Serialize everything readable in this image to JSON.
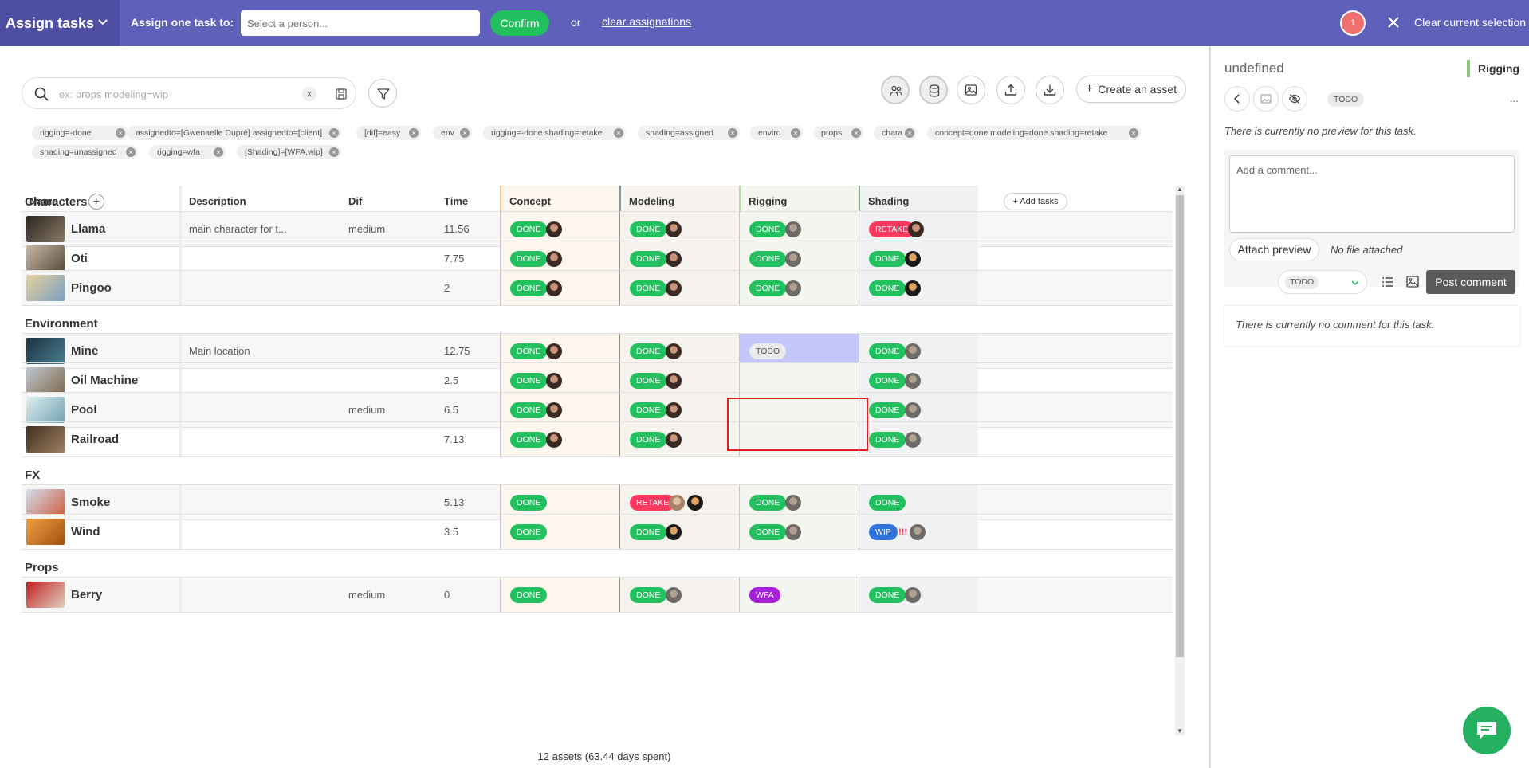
{
  "topbar": {
    "title": "Assign tasks",
    "assign_label": "Assign one task to:",
    "person_placeholder": "Select a person...",
    "confirm_label": "Confirm",
    "or_label": "or",
    "clear_assignations": "clear assignations",
    "selection_count": "1",
    "clear_selection": "Clear current selection",
    "bg_color": "#5e60ba"
  },
  "search": {
    "placeholder": "ex: props modeling=wip",
    "clear_label": "x"
  },
  "toolbar": {
    "create_asset": "Create an asset"
  },
  "filters": [
    "rigging=-done",
    "assignedto=[Gwenaelle Dupré] assignedto=[client]",
    "[dif]=easy",
    "env",
    "rigging=-done shading=retake",
    "shading=assigned",
    "enviro",
    "props",
    "chara",
    "concept=done modeling=done shading=retake",
    "shading=unassigned",
    "rigging=wfa",
    "[Shading]=[WFA,wip]"
  ],
  "table": {
    "columns": {
      "name": "Name",
      "description": "Description",
      "dif": "Dif",
      "time": "Time",
      "concept": "Concept",
      "modeling": "Modeling",
      "rigging": "Rigging",
      "shading": "Shading"
    },
    "add_tasks": "Add tasks",
    "groups": [
      {
        "label": "Characters"
      },
      {
        "label": "Environment"
      },
      {
        "label": "FX"
      },
      {
        "label": "Props"
      }
    ],
    "rows": [
      {
        "name": "Llama",
        "description": "main character for t...",
        "dif": "medium",
        "time": "11.56",
        "concept": "DONE",
        "modeling": "DONE",
        "rigging": "DONE",
        "shading": "RETAKE"
      },
      {
        "name": "Oti",
        "description": "",
        "dif": "",
        "time": "7.75",
        "concept": "DONE",
        "modeling": "DONE",
        "rigging": "DONE",
        "shading": "DONE"
      },
      {
        "name": "Pingoo",
        "description": "",
        "dif": "",
        "time": "2",
        "concept": "DONE",
        "modeling": "DONE",
        "rigging": "DONE",
        "shading": "DONE"
      },
      {
        "name": "Mine",
        "description": "Main location",
        "dif": "",
        "time": "12.75",
        "concept": "DONE",
        "modeling": "DONE",
        "rigging": "TODO",
        "shading": "DONE"
      },
      {
        "name": "Oil Machine",
        "description": "",
        "dif": "",
        "time": "2.5",
        "concept": "DONE",
        "modeling": "DONE",
        "rigging": "",
        "shading": "DONE"
      },
      {
        "name": "Pool",
        "description": "",
        "dif": "medium",
        "time": "6.5",
        "concept": "DONE",
        "modeling": "DONE",
        "rigging": "",
        "shading": "DONE"
      },
      {
        "name": "Railroad",
        "description": "",
        "dif": "",
        "time": "7.13",
        "concept": "DONE",
        "modeling": "DONE",
        "rigging": "",
        "shading": "DONE"
      },
      {
        "name": "Smoke",
        "description": "",
        "dif": "",
        "time": "5.13",
        "concept": "DONE",
        "modeling": "RETAKE",
        "rigging": "DONE",
        "shading": "DONE"
      },
      {
        "name": "Wind",
        "description": "",
        "dif": "",
        "time": "3.5",
        "concept": "DONE",
        "modeling": "DONE",
        "rigging": "DONE",
        "shading": "WIP",
        "shading_flag": "!!!"
      },
      {
        "name": "Berry",
        "description": "",
        "dif": "medium",
        "time": "0",
        "concept": "DONE",
        "modeling": "DONE",
        "rigging": "WFA",
        "shading": "DONE"
      }
    ]
  },
  "footer": "12 assets (63.44 days spent)",
  "panel": {
    "title": "undefined",
    "task_type": "Rigging",
    "status": "TODO",
    "more": "...",
    "no_preview": "There is currently no preview for this task.",
    "comment_placeholder": "Add a comment...",
    "attach_preview": "Attach preview",
    "no_file": "No file attached",
    "status_select": "TODO",
    "post_comment": "Post comment",
    "no_comment": "There is currently no comment for this task."
  },
  "colors": {
    "done": "#22c05e",
    "retake": "#ff3860",
    "wip": "#3273dc",
    "wfa": "#a821d9",
    "todo": "#eaeaea",
    "selected_cell": "#c5c6fa",
    "concept_col": "#fdf6ee",
    "modeling_col": "#f6f3ef",
    "rigging_col": "#f3f6ee",
    "shading_col": "#eff1f3"
  }
}
